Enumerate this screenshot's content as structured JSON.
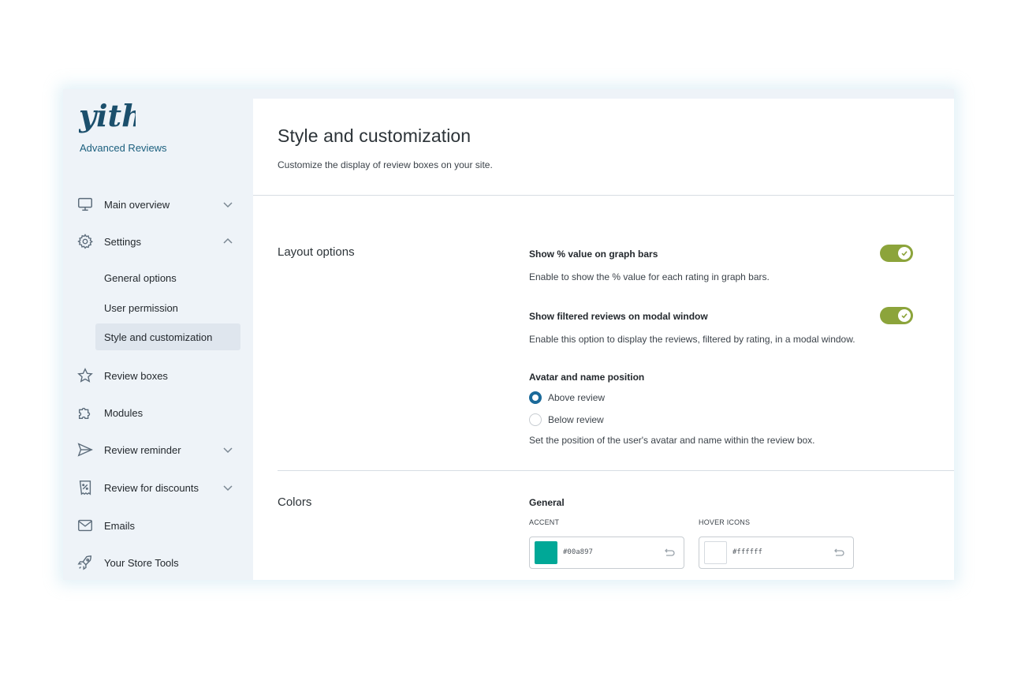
{
  "app": {
    "logo_text": "yith",
    "brand_subtitle": "Advanced Reviews"
  },
  "sidebar": {
    "items": [
      {
        "label": "Main overview",
        "icon": "monitor-icon",
        "chevron": "down"
      },
      {
        "label": "Settings",
        "icon": "gear-icon",
        "chevron": "up"
      },
      {
        "label": "Review boxes",
        "icon": "star-icon"
      },
      {
        "label": "Modules",
        "icon": "puzzle-icon"
      },
      {
        "label": "Review reminder",
        "icon": "paper-plane-icon",
        "chevron": "down"
      },
      {
        "label": "Review for discounts",
        "icon": "coupon-icon",
        "chevron": "down"
      },
      {
        "label": "Emails",
        "icon": "envelope-icon"
      },
      {
        "label": "Your Store Tools",
        "icon": "rocket-icon"
      }
    ],
    "settings_subitems": [
      {
        "label": "General options",
        "active": false
      },
      {
        "label": "User permission",
        "active": false
      },
      {
        "label": "Style and customization",
        "active": true
      }
    ]
  },
  "page": {
    "title": "Style and customization",
    "description": "Customize the display of review boxes on your site."
  },
  "layout_options": {
    "section_title": "Layout options",
    "show_percent": {
      "label": "Show % value on graph bars",
      "description": "Enable to show the % value for each rating in graph bars.",
      "enabled": true
    },
    "show_filtered": {
      "label": "Show filtered reviews on modal window",
      "description": "Enable this option to display the reviews, filtered by rating, in a modal window.",
      "enabled": true
    },
    "avatar_position": {
      "label": "Avatar and name position",
      "options": [
        "Above review",
        "Below review"
      ],
      "selected": "Above review",
      "description": "Set the position of the user's avatar and name within the review box."
    }
  },
  "colors": {
    "section_title": "Colors",
    "group_title": "General",
    "accent": {
      "label": "ACCENT",
      "value": "#00a897"
    },
    "hover_icons": {
      "label": "HOVER ICONS",
      "value": "#ffffff"
    }
  },
  "theme": {
    "toggle_on": "#8ca43b",
    "radio_selected": "#1b6a9a",
    "brand": "#1b5f7e"
  }
}
